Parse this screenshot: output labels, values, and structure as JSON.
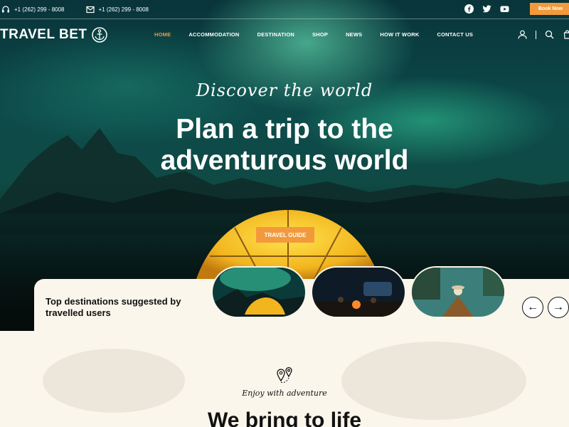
{
  "topbar": {
    "phone_1": "+1 (262) 299 - 8008",
    "phone_2": "+1 (262) 299 - 8008",
    "book_label": "Book Now",
    "social_icons": [
      "facebook-icon",
      "twitter-icon",
      "youtube-icon"
    ]
  },
  "brand": {
    "name": "TRAVEL BET"
  },
  "nav": {
    "items": [
      {
        "label": "HOME",
        "active": true
      },
      {
        "label": "ACCOMMODATION",
        "active": false
      },
      {
        "label": "DESTINATION",
        "active": false
      },
      {
        "label": "SHOP",
        "active": false
      },
      {
        "label": "NEWS",
        "active": false
      },
      {
        "label": "HOW IT WORK",
        "active": false
      },
      {
        "label": "CONTACT US",
        "active": false
      }
    ]
  },
  "hero": {
    "script_title": "Discover the world",
    "headline_line1": "Plan a trip to the",
    "headline_line2": "adventurous world",
    "guide_button": "TRAVEL GUIDE"
  },
  "destinations": {
    "heading": "Top destinations suggested by travelled users",
    "thumbnails": [
      "aurora-tent",
      "campfire-van",
      "boat-lake"
    ]
  },
  "section": {
    "eyebrow": "Enjoy with adventure",
    "title": "We bring to life"
  },
  "colors": {
    "accent": "#f29a3b",
    "cream": "#faf6ec",
    "hero_dark": "#0a2a2a",
    "aurora": "#78ffc8"
  }
}
